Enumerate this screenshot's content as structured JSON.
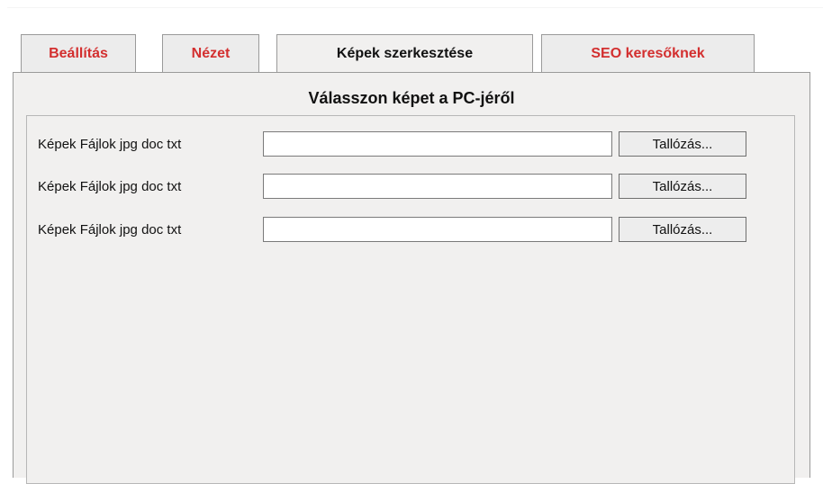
{
  "tabs": [
    {
      "label": "Beállítás"
    },
    {
      "label": "Nézet"
    },
    {
      "label": "Képek szerkesztése"
    },
    {
      "label": "SEO keresőknek"
    }
  ],
  "active_tab": "Képek szerkesztése",
  "panel": {
    "title": "Válasszon képet a PC-jéről",
    "rows": [
      {
        "label": "Képek Fájlok jpg doc txt",
        "value": "",
        "button": "Tallózás..."
      },
      {
        "label": "Képek Fájlok jpg doc txt",
        "value": "",
        "button": "Tallózás..."
      },
      {
        "label": "Képek Fájlok jpg doc txt",
        "value": "",
        "button": "Tallózás..."
      }
    ]
  },
  "colors": {
    "tab_text_inactive": "#d32f2f",
    "tab_text_active": "#111111",
    "panel_background": "#f1f0ef",
    "border": "#9a9a9a"
  }
}
